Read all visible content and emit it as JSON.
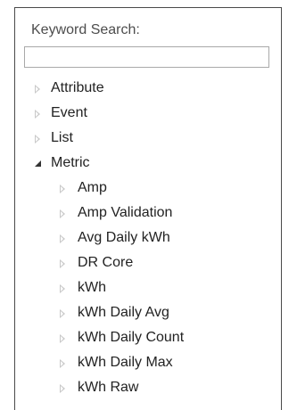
{
  "search": {
    "label": "Keyword Search:",
    "value": "",
    "placeholder": ""
  },
  "tree": {
    "items": [
      {
        "label": "Attribute",
        "state": "collapsed",
        "level": 0
      },
      {
        "label": "Event",
        "state": "collapsed",
        "level": 0
      },
      {
        "label": "List",
        "state": "collapsed",
        "level": 0
      },
      {
        "label": "Metric",
        "state": "expanded",
        "level": 0
      },
      {
        "label": "Amp",
        "state": "collapsed",
        "level": 1
      },
      {
        "label": "Amp Validation",
        "state": "collapsed",
        "level": 1
      },
      {
        "label": "Avg Daily kWh",
        "state": "collapsed",
        "level": 1
      },
      {
        "label": "DR Core",
        "state": "collapsed",
        "level": 1
      },
      {
        "label": "kWh",
        "state": "collapsed",
        "level": 1
      },
      {
        "label": "kWh Daily Avg",
        "state": "collapsed",
        "level": 1
      },
      {
        "label": "kWh Daily Count",
        "state": "collapsed",
        "level": 1
      },
      {
        "label": "kWh Daily Max",
        "state": "collapsed",
        "level": 1
      },
      {
        "label": "kWh Raw",
        "state": "collapsed",
        "level": 1
      }
    ]
  },
  "icons": {
    "collapsed": "triangle-right-icon",
    "expanded": "triangle-down-icon"
  },
  "colors": {
    "collapsed_arrow": "#c8c8c8",
    "expanded_arrow": "#333333",
    "text": "#222222"
  }
}
